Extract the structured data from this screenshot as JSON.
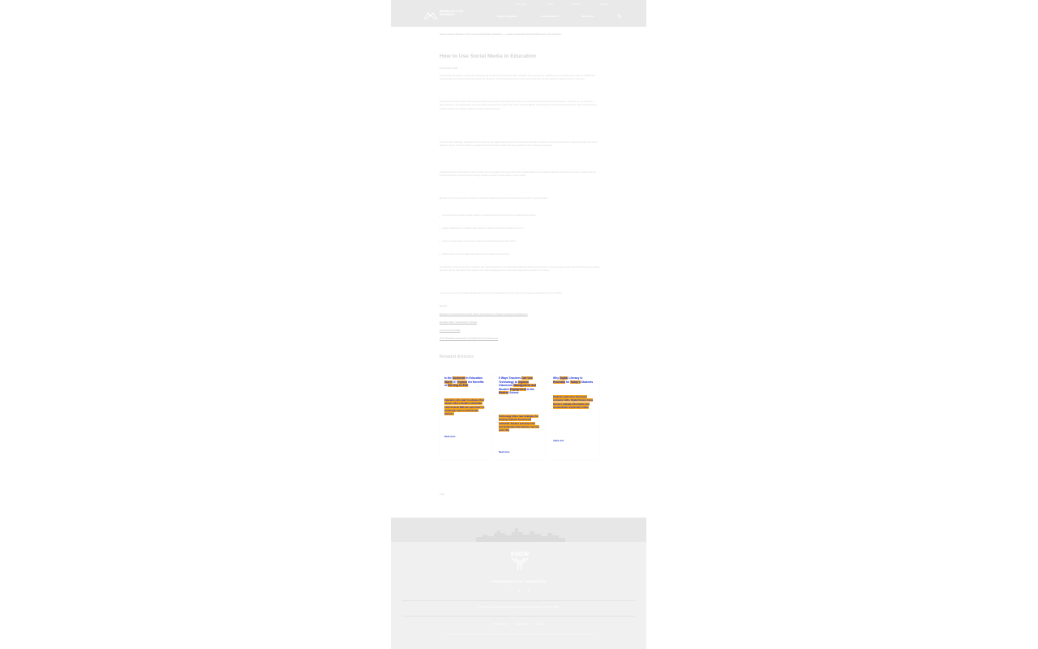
{
  "header": {
    "utility_links": [
      "Apply Now",
      "Give",
      "MyKSU",
      "Search"
    ],
    "logo_line1": "KENNESAW STATE",
    "logo_line2": "UNIVERSITY",
    "nav_items": [
      "Degree Programs",
      "Getting Started",
      "Resources"
    ],
    "colors": {
      "bar": "#e9e9e9"
    }
  },
  "article": {
    "breadcrumb": "Home / Articles / Education / How to Use Social Media in Education — a guide for educators exploring digital tools in the classroom",
    "title": "How to Use Social Media in Education",
    "byline": "Posted March 2022",
    "paragraphs": [
      "Social media has become a major part of everyday life for students and educators alike. Platforms once used only for socializing are now being used as tools for collaboration, communication and learning inside and outside the classroom. Understanding how to use these tools responsibly can help teachers engage students in new ways.",
      "Research shows that students who use social media as part of their coursework often feel more connected to their classmates and instructors. Teachers can use platforms to share resources, post assignments, start discussions and showcase student work. When used thoughtfully, social media can extend learning beyond the walls of the classroom and give students an authentic audience for their ideas and projects.",
      "There are also challenges. Educators must consider privacy, digital citizenship and the potential for distraction. Schools and districts typically have policies that guide how social platforms may be used with students, and teachers should become familiar with these guidelines before introducing new tools.",
      "A graduate degree in education can help teachers learn to integrate technology effectively, evaluate digital tools and design instruction that meets the needs of today's learners. Programs focused on instructional technology prepare educators to lead change in their schools.",
      "Benefits of using social media in education include the following opportunities for students and teachers to grow together:"
    ],
    "bullets": [
      "Improved communication between teachers, students and parents through timely updates and reminders.",
      "Greater collaboration as students work together on projects and share feedback with peers.",
      "Access to a wide range of resources, experts and communities beyond the school.",
      "Opportunities to practice digital citizenship and responsible online behavior."
    ],
    "closing_paragraphs": [
      "As technology continues to evolve, educators who understand how to use social media effectively will be well positioned to support student success. By combining sound teaching practices with the right digital tools, teachers can create engaging learning experiences that prepare students for the future.",
      "Learn more about how an online education degree from Kennesaw State University can help you integrate technology into your teaching."
    ],
    "sources_label": "Sources:",
    "sources": [
      "Edutopia, How Social Media Can Be Used in the Classroom to Support Learning and Engagement",
      "Education Week, Social Media in Schools",
      "Common Sense Media",
      "ISTE, Standards for Educators and Digital Citizenship Resources"
    ]
  },
  "related": {
    "title": "Related Articles",
    "cards": [
      {
        "title_parts": [
          "Is the ",
          "Doctorate",
          " in Education ",
          "Worth",
          " It? ",
          "Explore",
          " the Benefits of ",
          "Earning an EdD"
        ],
        "excerpt_parts": [
          "Educators who want to advance their careers often consider a doctorate. ",
          "Learn",
          " how an EdD can ",
          "open doors",
          " to leadership roles in schools and districts."
        ],
        "more": "Read more"
      },
      {
        "title_parts": [
          "5 Ways Teachers ",
          "Can Use",
          " Technology to ",
          "Improve",
          " Classroom ",
          "Management and",
          " Student ",
          "Engagement",
          " in the ",
          "Modern",
          " School"
        ],
        "excerpt_parts": [
          "Technology offers ",
          "new strategies",
          " for keeping students ",
          "focused",
          " and motivated. Explore ",
          "practical",
          " tools and techniques that teachers can use every day."
        ],
        "more": "Read more"
      },
      {
        "title_parts": [
          "Why ",
          "Digital",
          " Literacy Is ",
          "Essential",
          " for ",
          "Today's",
          " Students"
        ],
        "excerpt_parts": [
          "Students need more than basic computer skills. ",
          "Digital literacy",
          " helps learners ",
          "evaluate",
          " information and communicate responsibly online."
        ],
        "more": "Apply now"
      }
    ],
    "slide_control": "‹ ›"
  },
  "tags_label": "Tags:",
  "footer": {
    "university_name": "KENNESAW STATE UNIVERSITY",
    "logo_text": "KNOW",
    "social_icons": [
      "f",
      "ig",
      "in"
    ],
    "address": "© 2022 Kennesaw State University | Kennesaw, GA 30144 | 470-578-6000",
    "links": [
      "Privacy Policy",
      "Accessibility",
      "Sitemap"
    ],
    "legal": "Kennesaw State University is accredited by the Southern Association of Colleges and Schools Commission on Colleges to award associate, baccalaureate, master's, specialist and doctoral degrees."
  }
}
